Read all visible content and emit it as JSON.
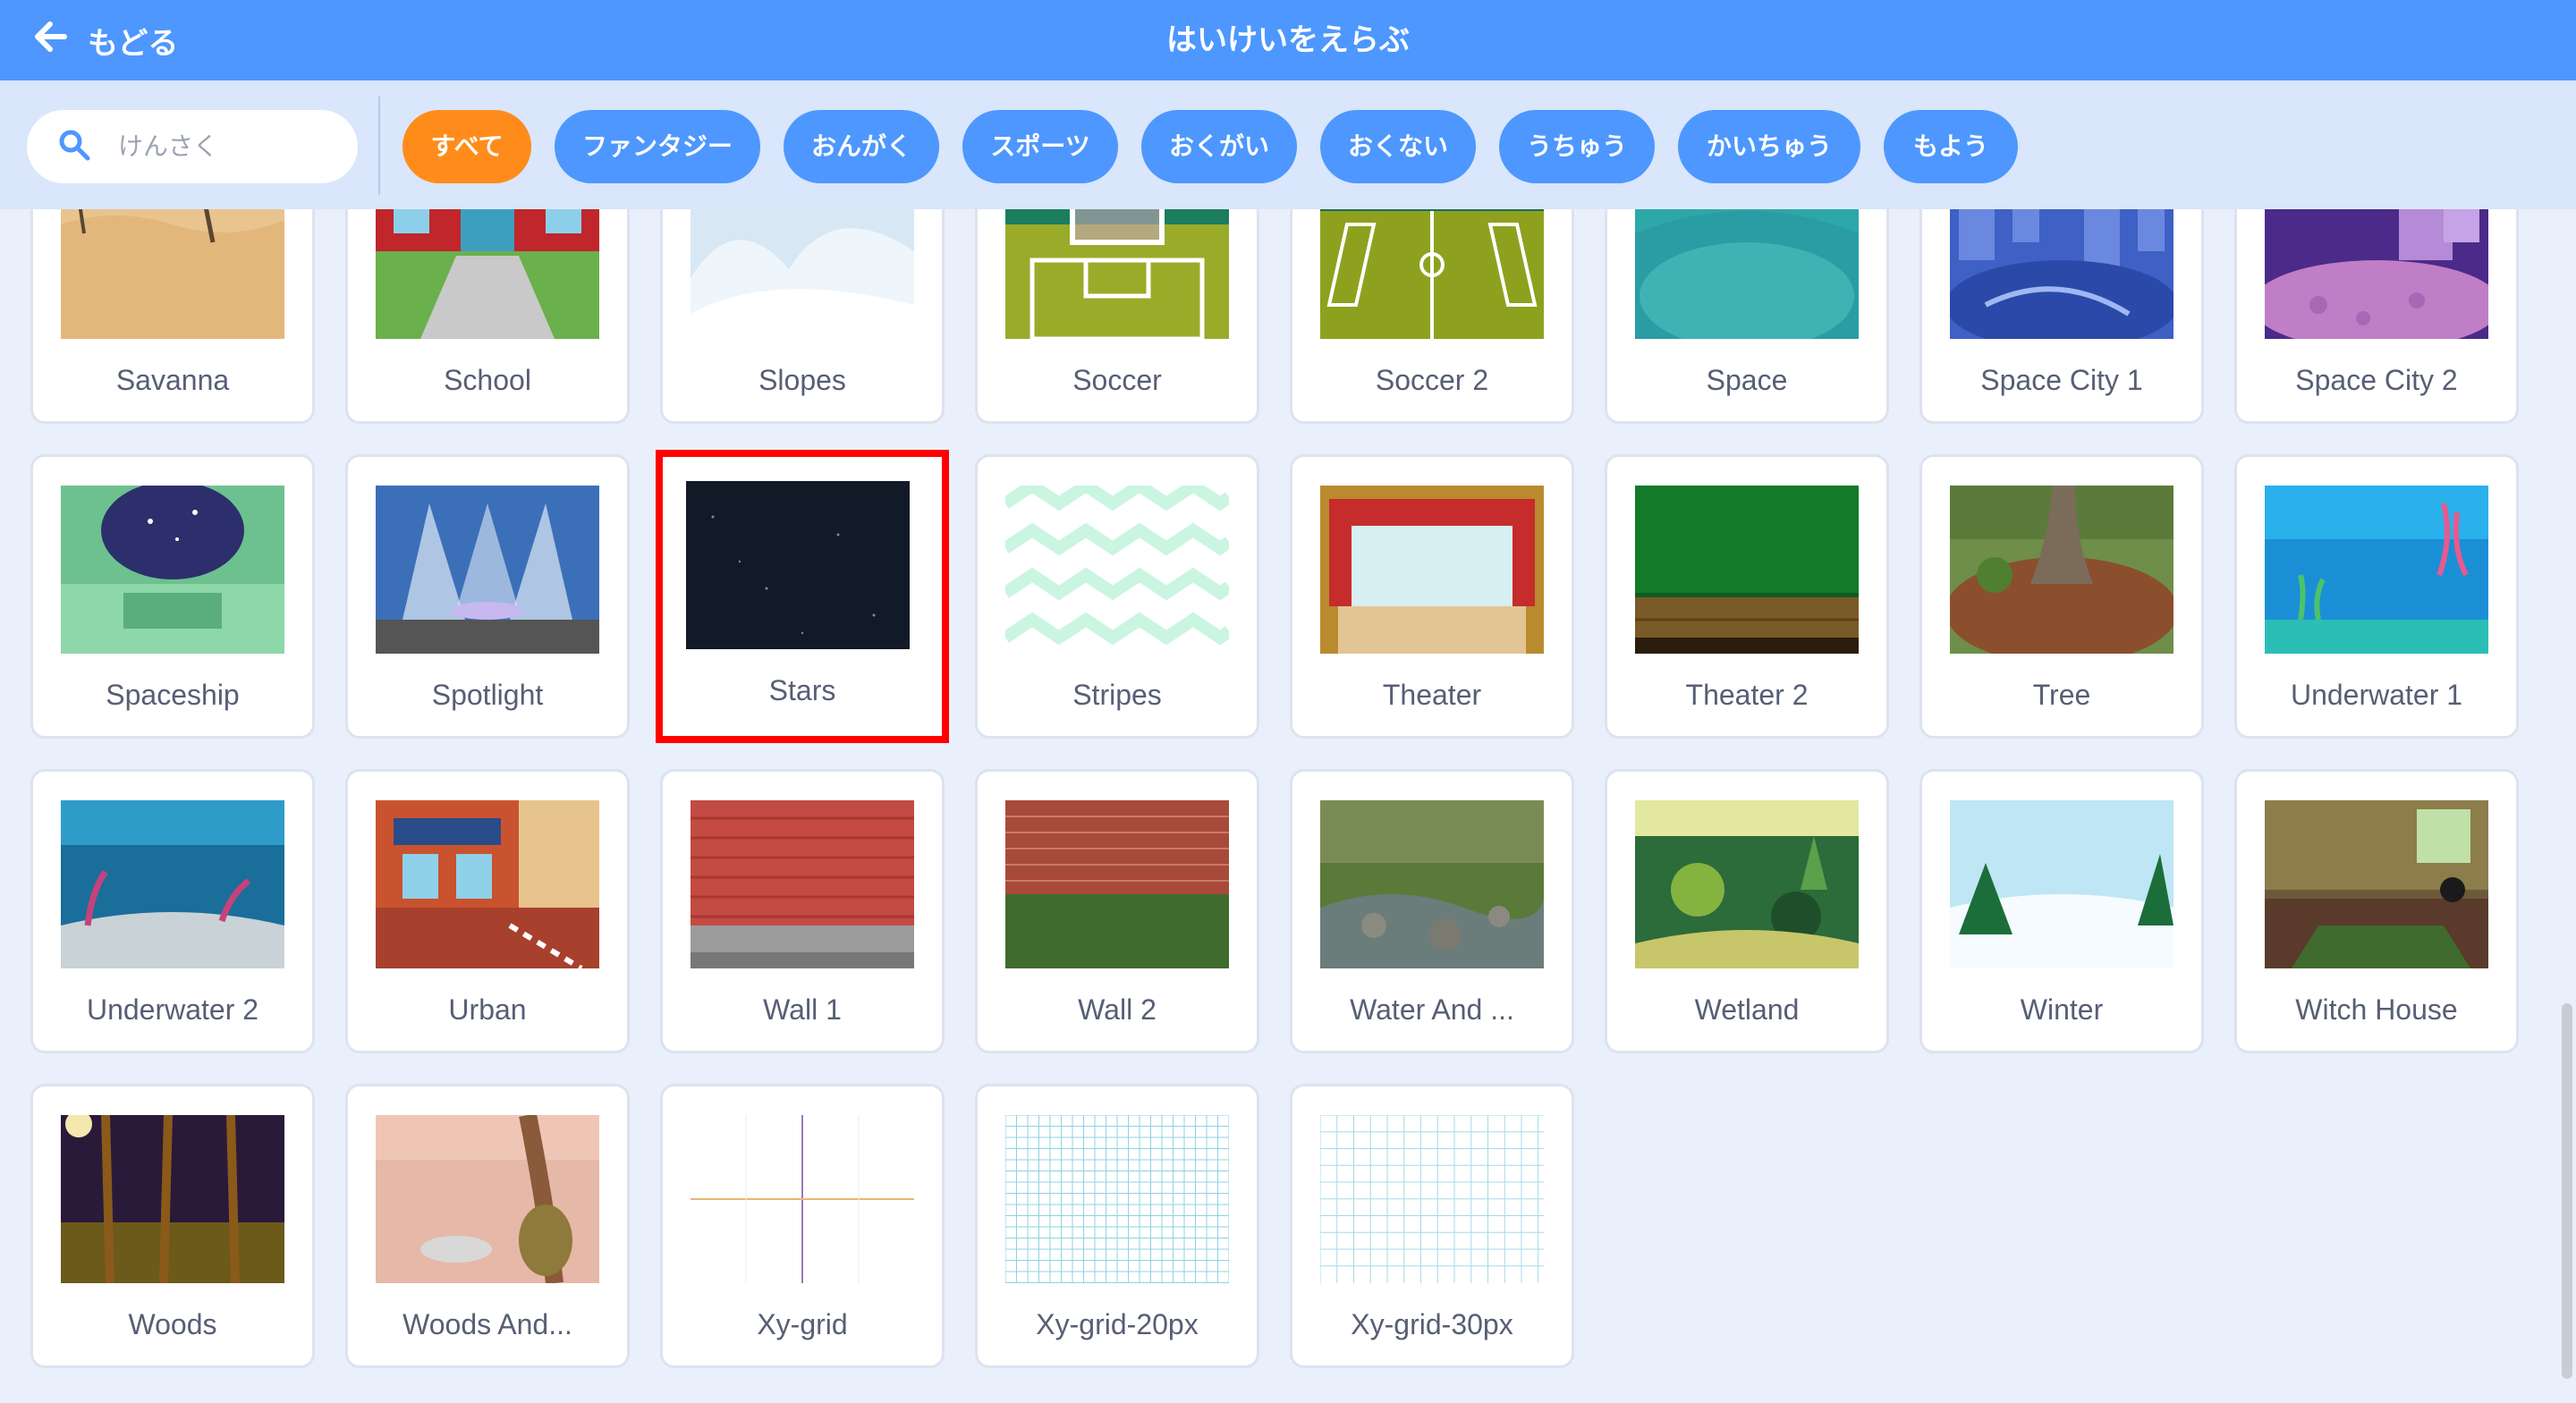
{
  "header": {
    "back_label": "もどる",
    "title": "はいけいをえらぶ"
  },
  "search": {
    "placeholder": "けんさく"
  },
  "tags": [
    {
      "label": "すべて",
      "active": true
    },
    {
      "label": "ファンタジー",
      "active": false
    },
    {
      "label": "おんがく",
      "active": false
    },
    {
      "label": "スポーツ",
      "active": false
    },
    {
      "label": "おくがい",
      "active": false
    },
    {
      "label": "おくない",
      "active": false
    },
    {
      "label": "うちゅう",
      "active": false
    },
    {
      "label": "かいちゅう",
      "active": false
    },
    {
      "label": "もよう",
      "active": false
    }
  ],
  "backdrops": [
    {
      "name": "Savanna",
      "icon": "savanna-thumbnail"
    },
    {
      "name": "School",
      "icon": "school-thumbnail"
    },
    {
      "name": "Slopes",
      "icon": "slopes-thumbnail"
    },
    {
      "name": "Soccer",
      "icon": "soccer-thumbnail"
    },
    {
      "name": "Soccer 2",
      "icon": "soccer-2-thumbnail"
    },
    {
      "name": "Space",
      "icon": "space-thumbnail"
    },
    {
      "name": "Space City 1",
      "icon": "space-city-1-thumbnail"
    },
    {
      "name": "Space City 2",
      "icon": "space-city-2-thumbnail"
    },
    {
      "name": "Spaceship",
      "icon": "spaceship-thumbnail"
    },
    {
      "name": "Spotlight",
      "icon": "spotlight-thumbnail"
    },
    {
      "name": "Stars",
      "icon": "stars-thumbnail",
      "selected": true
    },
    {
      "name": "Stripes",
      "icon": "stripes-thumbnail"
    },
    {
      "name": "Theater",
      "icon": "theater-thumbnail"
    },
    {
      "name": "Theater 2",
      "icon": "theater-2-thumbnail"
    },
    {
      "name": "Tree",
      "icon": "tree-thumbnail"
    },
    {
      "name": "Underwater 1",
      "icon": "underwater-1-thumbnail"
    },
    {
      "name": "Underwater 2",
      "icon": "underwater-2-thumbnail"
    },
    {
      "name": "Urban",
      "icon": "urban-thumbnail"
    },
    {
      "name": "Wall 1",
      "icon": "wall-1-thumbnail"
    },
    {
      "name": "Wall 2",
      "icon": "wall-2-thumbnail"
    },
    {
      "name": "Water And ...",
      "icon": "water-and-rocks-thumbnail"
    },
    {
      "name": "Wetland",
      "icon": "wetland-thumbnail"
    },
    {
      "name": "Winter",
      "icon": "winter-thumbnail"
    },
    {
      "name": "Witch House",
      "icon": "witch-house-thumbnail"
    },
    {
      "name": "Woods",
      "icon": "woods-thumbnail"
    },
    {
      "name": "Woods And...",
      "icon": "woods-and-bench-thumbnail"
    },
    {
      "name": "Xy-grid",
      "icon": "xy-grid-thumbnail"
    },
    {
      "name": "Xy-grid-20px",
      "icon": "xy-grid-20px-thumbnail"
    },
    {
      "name": "Xy-grid-30px",
      "icon": "xy-grid-30px-thumbnail"
    }
  ],
  "colors": {
    "header": "#4d97ff",
    "filter_bar": "#d9e6fb",
    "active_tag": "#ff8c1a",
    "tag": "#4d97ff",
    "selection": "#ff0000",
    "label_text": "#575e75"
  }
}
